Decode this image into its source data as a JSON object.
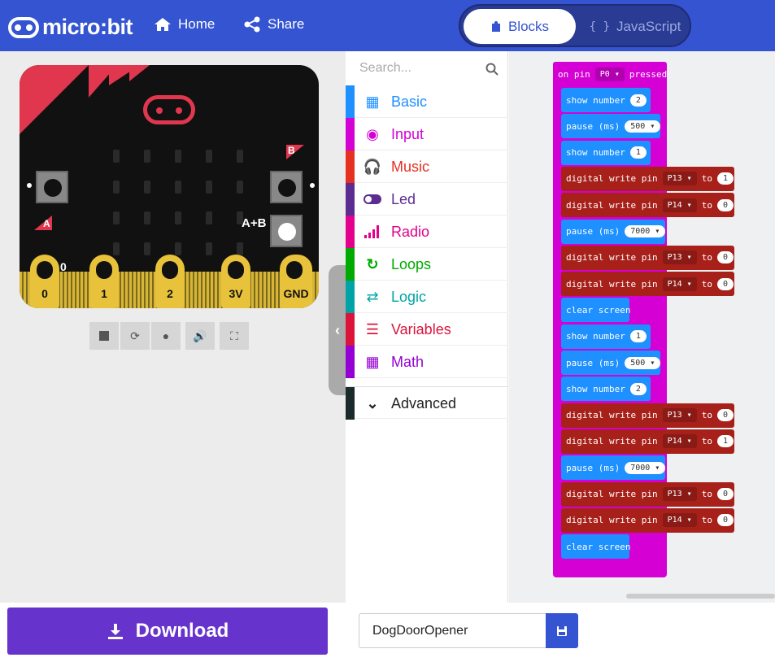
{
  "header": {
    "logo_text": "micro:bit",
    "home_label": "Home",
    "share_label": "Share",
    "blocks_label": "Blocks",
    "javascript_label": "JavaScript",
    "js_brace": "{ }"
  },
  "simulator": {
    "pin_labels": [
      "0",
      "1",
      "2",
      "3V",
      "GND"
    ],
    "button_a": "A",
    "button_b": "B",
    "button_ab": "A+B",
    "pin0_value": "0"
  },
  "toolbox": {
    "search_placeholder": "Search...",
    "categories": [
      {
        "label": "Basic",
        "color": "#1e90ff"
      },
      {
        "label": "Input",
        "color": "#d400d4"
      },
      {
        "label": "Music",
        "color": "#e63022"
      },
      {
        "label": "Led",
        "color": "#5c2d91"
      },
      {
        "label": "Radio",
        "color": "#e3008c"
      },
      {
        "label": "Loops",
        "color": "#00aa00"
      },
      {
        "label": "Logic",
        "color": "#00a4a6"
      },
      {
        "label": "Variables",
        "color": "#dc143c"
      },
      {
        "label": "Math",
        "color": "#9400d3"
      },
      {
        "label": "Advanced",
        "color": "#000000"
      }
    ]
  },
  "workspace": {
    "hat": {
      "prefix": "on pin",
      "pin": "P0",
      "suffix": "pressed"
    },
    "blocks": [
      {
        "type": "show",
        "label": "show number",
        "value": "2"
      },
      {
        "type": "pause",
        "label": "pause (ms)",
        "value": "500"
      },
      {
        "type": "show",
        "label": "show number",
        "value": "1"
      },
      {
        "type": "dw",
        "label": "digital write pin",
        "pin": "P13",
        "to": "to",
        "value": "1"
      },
      {
        "type": "dw",
        "label": "digital write pin",
        "pin": "P14",
        "to": "to",
        "value": "0"
      },
      {
        "type": "pause",
        "label": "pause (ms)",
        "value": "7000"
      },
      {
        "type": "dw",
        "label": "digital write pin",
        "pin": "P13",
        "to": "to",
        "value": "0"
      },
      {
        "type": "dw",
        "label": "digital write pin",
        "pin": "P14",
        "to": "to",
        "value": "0"
      },
      {
        "type": "clear",
        "label": "clear screen"
      },
      {
        "type": "show",
        "label": "show number",
        "value": "1"
      },
      {
        "type": "pause",
        "label": "pause (ms)",
        "value": "500"
      },
      {
        "type": "show",
        "label": "show number",
        "value": "2"
      },
      {
        "type": "dw",
        "label": "digital write pin",
        "pin": "P13",
        "to": "to",
        "value": "0"
      },
      {
        "type": "dw",
        "label": "digital write pin",
        "pin": "P14",
        "to": "to",
        "value": "1"
      },
      {
        "type": "pause",
        "label": "pause (ms)",
        "value": "7000"
      },
      {
        "type": "dw",
        "label": "digital write pin",
        "pin": "P13",
        "to": "to",
        "value": "0"
      },
      {
        "type": "dw",
        "label": "digital write pin",
        "pin": "P14",
        "to": "to",
        "value": "0"
      },
      {
        "type": "clear",
        "label": "clear screen"
      }
    ]
  },
  "footer": {
    "download_label": "Download",
    "project_name": "DogDoorOpener"
  }
}
